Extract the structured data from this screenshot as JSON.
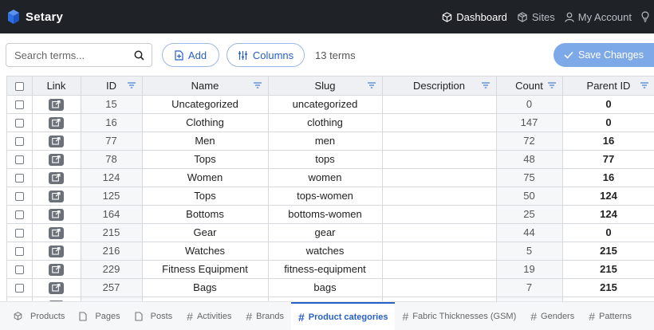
{
  "app": {
    "name": "Setary"
  },
  "nav": [
    {
      "label": "Dashboard",
      "icon": "cube-icon",
      "active": true
    },
    {
      "label": "Sites",
      "icon": "cubes-icon",
      "active": false
    },
    {
      "label": "My Account",
      "icon": "user-icon",
      "active": false
    }
  ],
  "toolbar": {
    "search_placeholder": "Search terms...",
    "add_label": "Add",
    "columns_label": "Columns",
    "terms_count": "13 terms",
    "save_label": "Save Changes"
  },
  "table": {
    "columns": [
      "Link",
      "ID",
      "Name",
      "Slug",
      "Description",
      "Count",
      "Parent ID"
    ],
    "rows": [
      {
        "id": "15",
        "name": "Uncategorized",
        "slug": "uncategorized",
        "description": "",
        "count": "0",
        "parent": "0"
      },
      {
        "id": "16",
        "name": "Clothing",
        "slug": "clothing",
        "description": "",
        "count": "147",
        "parent": "0"
      },
      {
        "id": "77",
        "name": "Men",
        "slug": "men",
        "description": "",
        "count": "72",
        "parent": "16"
      },
      {
        "id": "78",
        "name": "Tops",
        "slug": "tops",
        "description": "",
        "count": "48",
        "parent": "77"
      },
      {
        "id": "124",
        "name": "Women",
        "slug": "women",
        "description": "",
        "count": "75",
        "parent": "16"
      },
      {
        "id": "125",
        "name": "Tops",
        "slug": "tops-women",
        "description": "",
        "count": "50",
        "parent": "124"
      },
      {
        "id": "164",
        "name": "Bottoms",
        "slug": "bottoms-women",
        "description": "",
        "count": "25",
        "parent": "124"
      },
      {
        "id": "215",
        "name": "Gear",
        "slug": "gear",
        "description": "",
        "count": "44",
        "parent": "0"
      },
      {
        "id": "216",
        "name": "Watches",
        "slug": "watches",
        "description": "",
        "count": "5",
        "parent": "215"
      },
      {
        "id": "229",
        "name": "Fitness Equipment",
        "slug": "fitness-equipment",
        "description": "",
        "count": "19",
        "parent": "215"
      },
      {
        "id": "257",
        "name": "Bags",
        "slug": "bags",
        "description": "",
        "count": "7",
        "parent": "215"
      },
      {
        "id": "",
        "name": "",
        "slug": "",
        "description": "",
        "count": "",
        "parent": ""
      }
    ]
  },
  "bottom_tabs": [
    {
      "label": "Products",
      "icon": "cube-icon",
      "active": false
    },
    {
      "label": "Pages",
      "icon": "page-icon",
      "active": false
    },
    {
      "label": "Posts",
      "icon": "page-icon",
      "active": false
    },
    {
      "label": "Activities",
      "icon": "hash-icon",
      "active": false
    },
    {
      "label": "Brands",
      "icon": "hash-icon",
      "active": false
    },
    {
      "label": "Product categories",
      "icon": "hash-icon",
      "active": true
    },
    {
      "label": "Fabric Thicknesses (GSM)",
      "icon": "hash-icon",
      "active": false
    },
    {
      "label": "Genders",
      "icon": "hash-icon",
      "active": false
    },
    {
      "label": "Patterns",
      "icon": "hash-icon",
      "active": false
    }
  ],
  "colors": {
    "topbar": "#1f2328",
    "accent": "#2860c9",
    "save_button": "#7ea9e8",
    "logo": "#2f6fe0"
  }
}
